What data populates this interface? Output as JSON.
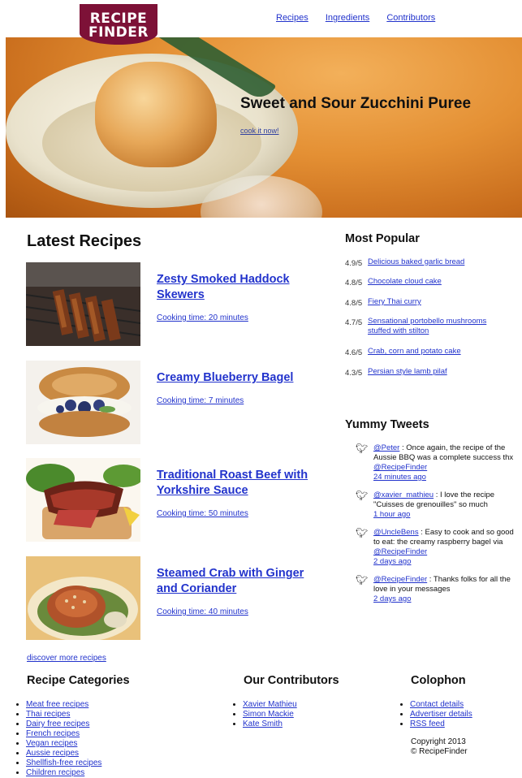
{
  "header": {
    "logo_line1": "RECIPE",
    "logo_line2": "FINDER",
    "nav": [
      {
        "label": "Recipes"
      },
      {
        "label": "Ingredients"
      },
      {
        "label": "Contributors"
      }
    ]
  },
  "hero": {
    "title": "Sweet and Sour Zucchini Puree",
    "link": "cook it now!"
  },
  "latest": {
    "title": "Latest Recipes",
    "recipes": [
      {
        "name": "Zesty Smoked Haddock Skewers",
        "time": "Cooking time: 20 minutes"
      },
      {
        "name": "Creamy Blueberry Bagel",
        "time": "Cooking time: 7 minutes"
      },
      {
        "name": "Traditional Roast Beef with Yorkshire Sauce",
        "time": "Cooking time: 50 minutes"
      },
      {
        "name": "Steamed Crab with Ginger and Coriander",
        "time": "Cooking time: 40 minutes"
      }
    ],
    "discover": "discover more recipes"
  },
  "popular": {
    "title": "Most Popular",
    "items": [
      {
        "rating": "4.9/5",
        "name": "Delicious baked garlic bread"
      },
      {
        "rating": "4.8/5",
        "name": "Chocolate cloud cake"
      },
      {
        "rating": "4.8/5",
        "name": "Fiery Thai curry"
      },
      {
        "rating": "4.7/5",
        "name": "Sensational portobello mushrooms stuffed with stilton"
      },
      {
        "rating": "4.6/5",
        "name": "Crab, corn and potato cake"
      },
      {
        "rating": "4.3/5",
        "name": "Persian style lamb pilaf"
      }
    ]
  },
  "tweets": {
    "title": "Yummy Tweets",
    "items": [
      {
        "user": "@Peter",
        "text": " : Once again, the recipe of the Aussie BBQ was a complete success thx ",
        "mention": "@RecipeFinder",
        "tail": "",
        "time": "24 minutes ago"
      },
      {
        "user": "@xavier_mathieu",
        "text": " : I love the recipe \"Cuisses de grenouilles\" so much",
        "mention": "",
        "tail": "",
        "time": "1 hour ago"
      },
      {
        "user": "@UncleBens",
        "text": " : Easy to cook and so good to eat: the creamy raspberry bagel via ",
        "mention": "@RecipeFinder",
        "tail": "",
        "time": "2 days ago"
      },
      {
        "user": "@RecipeFinder",
        "text": " : Thanks folks for all the love in your messages",
        "mention": "",
        "tail": "",
        "time": "2 days ago"
      }
    ]
  },
  "footer": {
    "categories": {
      "title": "Recipe Categories",
      "items": [
        "Meat free recipes",
        "Thai recipes",
        "Dairy free recipes",
        "French recipes",
        "Vegan recipes",
        "Aussie recipes",
        "Shellfish-free recipes",
        "Children recipes"
      ]
    },
    "contributors": {
      "title": "Our Contributors",
      "items": [
        "Xavier Mathieu",
        "Simon Mackie",
        "Kate Smith"
      ]
    },
    "colophon": {
      "title": "Colophon",
      "items": [
        "Contact details",
        "Advertiser details",
        "RSS feed"
      ],
      "copyright_line1": "Copyright 2013",
      "copyright_line2": "© RecipeFinder"
    }
  },
  "colors": {
    "brand": "#7d1137",
    "link": "#2233cc",
    "hero_orange": "#e49034"
  }
}
